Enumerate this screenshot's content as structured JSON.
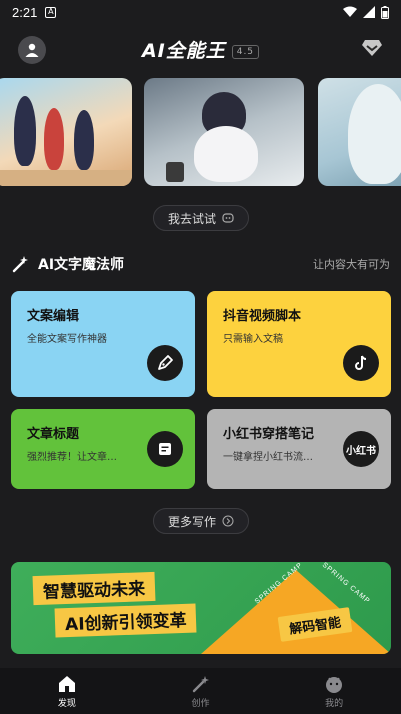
{
  "status": {
    "time": "2:21"
  },
  "header": {
    "title": "AI全能王",
    "version": "4.5"
  },
  "try_button": {
    "label": "我去试试"
  },
  "section": {
    "title": "AI文字魔法师",
    "subtitle": "让内容大有可为"
  },
  "cards": [
    {
      "title": "文案编辑",
      "desc": "全能文案写作神器",
      "icon": "pen-icon",
      "color": "#8ad4f3"
    },
    {
      "title": "抖音视频脚本",
      "desc": "只需输入文稿",
      "icon": "tiktok-icon",
      "color": "#fdd23e"
    },
    {
      "title": "文章标题",
      "desc": "强烈推荐！让文章…",
      "icon": "document-icon",
      "color": "#62c23b"
    },
    {
      "title": "小红书穿搭笔记",
      "desc": "一键拿捏小红书流…",
      "icon": "xiaohongshu-icon",
      "icon_text": "小红书",
      "color": "#b4b4b4"
    }
  ],
  "more_button": {
    "label": "更多写作"
  },
  "banner": {
    "line1": "智慧驱动未来",
    "line2": "AI创新引领变革",
    "tag": "解码智能",
    "camp_text": "SPRING CAMP"
  },
  "tabs": [
    {
      "label": "发现",
      "icon": "home-icon",
      "active": true
    },
    {
      "label": "创作",
      "icon": "magic-wand-icon",
      "active": false
    },
    {
      "label": "我的",
      "icon": "profile-face-icon",
      "active": false
    }
  ]
}
